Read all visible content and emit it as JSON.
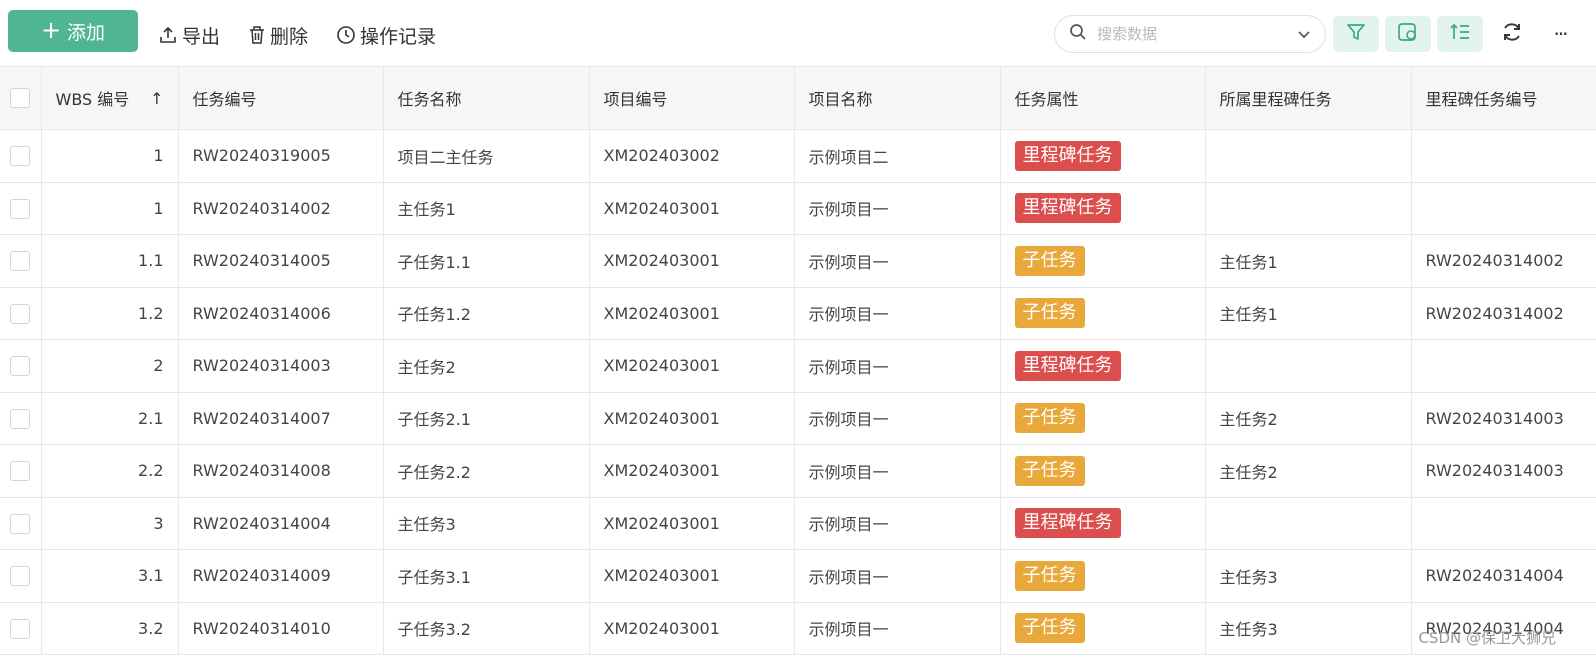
{
  "toolbar": {
    "add_label": "添加",
    "export_label": "导出",
    "delete_label": "删除",
    "log_label": "操作记录",
    "search_placeholder": "搜索数据"
  },
  "colors": {
    "primary": "#4fb594",
    "milestone_tag": "#dc4d4d",
    "subtask_tag": "#e8a83a"
  },
  "table": {
    "columns": [
      "WBS 编号",
      "任务编号",
      "任务名称",
      "项目编号",
      "项目名称",
      "任务属性",
      "所属里程碑任务",
      "里程碑任务编号"
    ],
    "sort_indicator": "↑",
    "rows": [
      {
        "wbs": "1",
        "task_no": "RW20240319005",
        "task_name": "项目二主任务",
        "project_no": "XM202403002",
        "project_name": "示例项目二",
        "attr": "里程碑任务",
        "attr_type": "milestone",
        "milestone": "",
        "milestone_no": ""
      },
      {
        "wbs": "1",
        "task_no": "RW20240314002",
        "task_name": "主任务1",
        "project_no": "XM202403001",
        "project_name": "示例项目一",
        "attr": "里程碑任务",
        "attr_type": "milestone",
        "milestone": "",
        "milestone_no": ""
      },
      {
        "wbs": "1.1",
        "task_no": "RW20240314005",
        "task_name": "子任务1.1",
        "project_no": "XM202403001",
        "project_name": "示例项目一",
        "attr": "子任务",
        "attr_type": "sub",
        "milestone": "主任务1",
        "milestone_no": "RW20240314002"
      },
      {
        "wbs": "1.2",
        "task_no": "RW20240314006",
        "task_name": "子任务1.2",
        "project_no": "XM202403001",
        "project_name": "示例项目一",
        "attr": "子任务",
        "attr_type": "sub",
        "milestone": "主任务1",
        "milestone_no": "RW20240314002"
      },
      {
        "wbs": "2",
        "task_no": "RW20240314003",
        "task_name": "主任务2",
        "project_no": "XM202403001",
        "project_name": "示例项目一",
        "attr": "里程碑任务",
        "attr_type": "milestone",
        "milestone": "",
        "milestone_no": ""
      },
      {
        "wbs": "2.1",
        "task_no": "RW20240314007",
        "task_name": "子任务2.1",
        "project_no": "XM202403001",
        "project_name": "示例项目一",
        "attr": "子任务",
        "attr_type": "sub",
        "milestone": "主任务2",
        "milestone_no": "RW20240314003"
      },
      {
        "wbs": "2.2",
        "task_no": "RW20240314008",
        "task_name": "子任务2.2",
        "project_no": "XM202403001",
        "project_name": "示例项目一",
        "attr": "子任务",
        "attr_type": "sub",
        "milestone": "主任务2",
        "milestone_no": "RW20240314003"
      },
      {
        "wbs": "3",
        "task_no": "RW20240314004",
        "task_name": "主任务3",
        "project_no": "XM202403001",
        "project_name": "示例项目一",
        "attr": "里程碑任务",
        "attr_type": "milestone",
        "milestone": "",
        "milestone_no": ""
      },
      {
        "wbs": "3.1",
        "task_no": "RW20240314009",
        "task_name": "子任务3.1",
        "project_no": "XM202403001",
        "project_name": "示例项目一",
        "attr": "子任务",
        "attr_type": "sub",
        "milestone": "主任务3",
        "milestone_no": "RW20240314004"
      },
      {
        "wbs": "3.2",
        "task_no": "RW20240314010",
        "task_name": "子任务3.2",
        "project_no": "XM202403001",
        "project_name": "示例项目一",
        "attr": "子任务",
        "attr_type": "sub",
        "milestone": "主任务3",
        "milestone_no": "RW20240314004"
      }
    ]
  },
  "watermark": "CSDN @保卫大狮兄"
}
